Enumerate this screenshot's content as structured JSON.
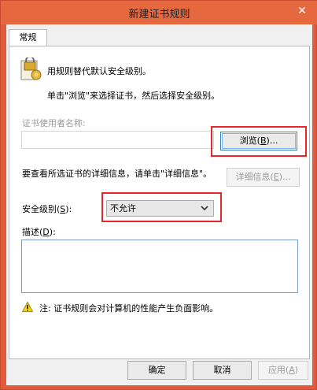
{
  "window": {
    "title": "新建证书规则",
    "close_glyph": "✕"
  },
  "tab": {
    "label": "常规"
  },
  "intro": {
    "line1": "用规则替代默认安全级别。",
    "line2": "单击\"浏览\"来选择证书，然后选择安全级别。"
  },
  "cert_user": {
    "label": "证书使用者名称:",
    "value": "",
    "browse_prefix": "浏览(",
    "browse_key": "B",
    "browse_suffix": ")..."
  },
  "details": {
    "text": "要查看所选证书的详细信息，请单击\"详细信息\"。",
    "button_prefix": "详细信息(",
    "button_key": "E",
    "button_suffix": ")..."
  },
  "security": {
    "label_prefix": "安全级别(",
    "label_key": "S",
    "label_suffix": "):",
    "selected": "不允许"
  },
  "description": {
    "label_prefix": "描述(",
    "label_key": "D",
    "label_suffix": "):",
    "value": ""
  },
  "note": {
    "text": "注: 证书规则会对计算机的性能产生负面影响。"
  },
  "footer": {
    "ok_label": "确定",
    "cancel_label": "取消",
    "apply_prefix": "应用(",
    "apply_key": "A",
    "apply_suffix": ")"
  },
  "colors": {
    "titlebar": "#e6683f",
    "highlight": "#e8262b",
    "disabled_text": "#9a9a9a"
  },
  "icons": {
    "certificate": "certificate-lock-icon",
    "warning": "warning-icon",
    "dropdown": "chevron-down-icon",
    "close": "close-icon"
  }
}
